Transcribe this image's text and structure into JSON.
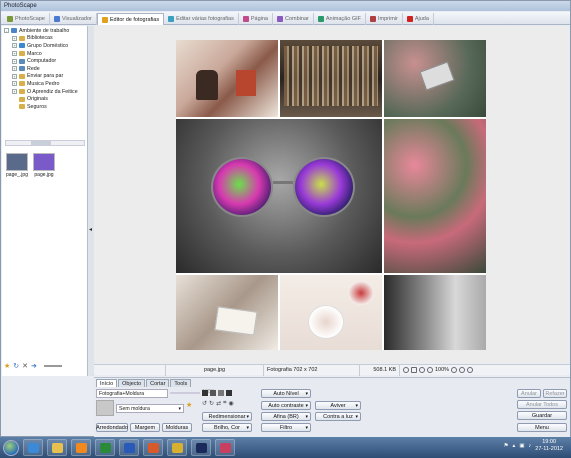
{
  "window": {
    "title": "PhotoScape"
  },
  "tabs": [
    {
      "label": "PhotoScape",
      "color": "#7a9a3a"
    },
    {
      "label": "Visualizador",
      "color": "#4a7bd0"
    },
    {
      "label": "Editor de fotografias",
      "color": "#e0a020"
    },
    {
      "label": "Editar várias fotografias",
      "color": "#3aa0c0"
    },
    {
      "label": "Página",
      "color": "#c04a8a"
    },
    {
      "label": "Combinar",
      "color": "#8a5ac0"
    },
    {
      "label": "Animação GIF",
      "color": "#2a9a6a"
    },
    {
      "label": "Imprimir",
      "color": "#b04040"
    },
    {
      "label": "Ajuda",
      "color": "#d02020"
    }
  ],
  "active_tab_index": 2,
  "tree": [
    {
      "label": "Ambiente de trabalho",
      "indent": 0,
      "exp": "-",
      "color": "#4a86c8"
    },
    {
      "label": "Bibliotecas",
      "indent": 1,
      "exp": "+",
      "color": "#d8b04a"
    },
    {
      "label": "Grupo Doméstico",
      "indent": 1,
      "exp": "+",
      "color": "#3a8ad0"
    },
    {
      "label": "Marco",
      "indent": 1,
      "exp": "+",
      "color": "#d8b04a"
    },
    {
      "label": "Computador",
      "indent": 1,
      "exp": "+",
      "color": "#5a8ab8"
    },
    {
      "label": "Rede",
      "indent": 1,
      "exp": "+",
      "color": "#5a8ab8"
    },
    {
      "label": "Enviar para par",
      "indent": 1,
      "exp": "+",
      "color": "#d8b04a"
    },
    {
      "label": "Musica Pedro",
      "indent": 1,
      "exp": "+",
      "color": "#d8b04a"
    },
    {
      "label": "O Aprendiz  da Feitice",
      "indent": 1,
      "exp": "+",
      "color": "#d8b04a"
    },
    {
      "label": "Originais",
      "indent": 1,
      "exp": "",
      "color": "#d8b04a"
    },
    {
      "label": "Seguros",
      "indent": 1,
      "exp": "",
      "color": "#d8b04a"
    }
  ],
  "thumbnails": [
    {
      "label": "page_.jpg",
      "color": "#5a6a8a"
    },
    {
      "label": "page.jpg",
      "color": "#7a5ac8"
    }
  ],
  "status": {
    "filename": "page.jpg",
    "info": "Fotografia 702 x 702",
    "size": "508.1 KB",
    "zoom": "100%"
  },
  "panel": {
    "tabs": [
      "Início",
      "Objecto",
      "Cortar",
      "Tools"
    ],
    "frame_field": "Fotografia+Moldura",
    "frame_pct": "100%",
    "frame_select": "Sem moldura",
    "buttons": {
      "round": "Arredondado",
      "margin": "Margem",
      "frames": "Molduras",
      "auto_level": "Auto Nível",
      "auto_contrast": "Auto contraste",
      "resize": "Redimensionar",
      "brightness": "Brilho, Cor",
      "sharpen": "Afina (BR)",
      "filter": "Filtro",
      "whiten": "Aviver",
      "backlight": "Contra a luz",
      "undo": "Anular",
      "redo": "Refazer",
      "undo_all": "Anular Todos",
      "save": "Guardar",
      "menu": "Menu"
    }
  },
  "taskbar": {
    "apps": [
      {
        "name": "ie",
        "color": "#3a8ad8"
      },
      {
        "name": "explorer",
        "color": "#e8c050"
      },
      {
        "name": "media",
        "color": "#f08a20"
      },
      {
        "name": "excel",
        "color": "#2a8a3a"
      },
      {
        "name": "word",
        "color": "#2a5ab8"
      },
      {
        "name": "powerpoint",
        "color": "#d85a2a"
      },
      {
        "name": "chrome",
        "color": "#d8b030"
      },
      {
        "name": "photoshop",
        "color": "#1a2a5a"
      },
      {
        "name": "photoscape",
        "color": "#c84060"
      }
    ],
    "time": "19:00",
    "date": "27-11-2012"
  }
}
